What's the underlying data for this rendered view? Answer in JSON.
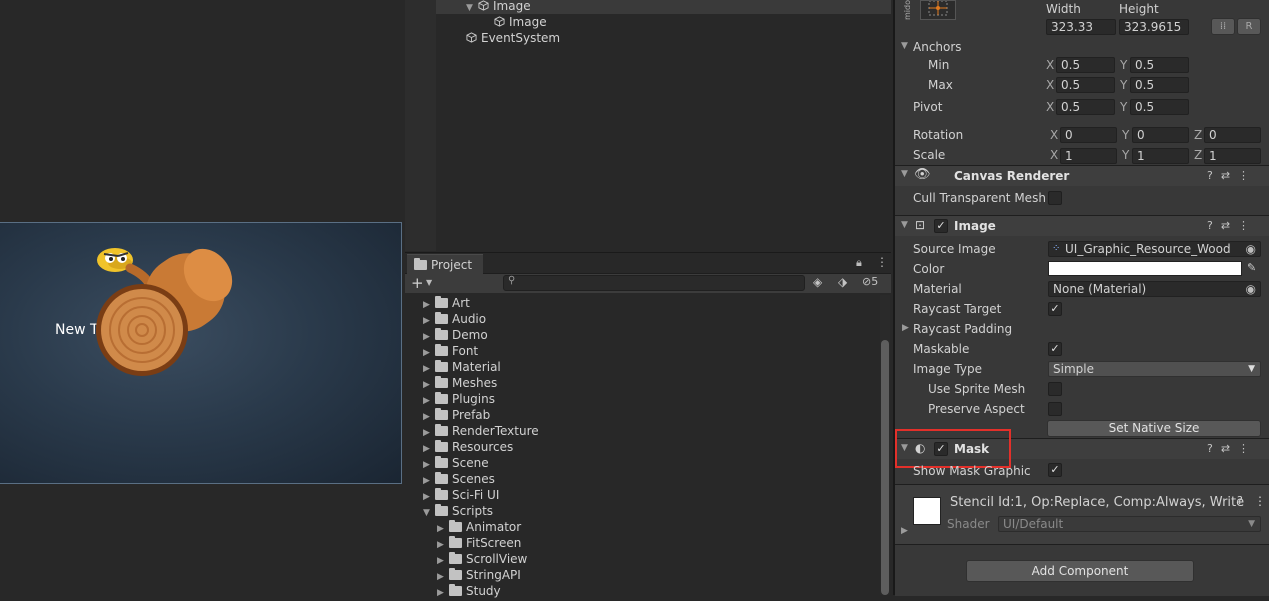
{
  "scene": {
    "text_label": "New T"
  },
  "hierarchy": {
    "items": [
      {
        "label": "Image",
        "depth": 1,
        "expanded": true
      },
      {
        "label": "Image",
        "depth": 2
      },
      {
        "label": "EventSystem",
        "depth": 0
      }
    ]
  },
  "project": {
    "tab_label": "Project",
    "hidden_count": "5",
    "folders": [
      "Art",
      "Audio",
      "Demo",
      "Font",
      "Material",
      "Meshes",
      "Plugins",
      "Prefab",
      "RenderTexture",
      "Resources",
      "Scene",
      "Scenes",
      "Sci-Fi UI",
      "Scripts"
    ],
    "script_children": [
      "Animator",
      "FitScreen",
      "ScrollView",
      "StringAPI",
      "Study"
    ]
  },
  "inspector": {
    "rect": {
      "preset_label": "mido",
      "width_label": "Width",
      "height_label": "Height",
      "width": "323.33",
      "height": "323.9615",
      "r_button": "R",
      "anchors_label": "Anchors",
      "min_label": "Min",
      "max_label": "Max",
      "min_x": "0.5",
      "min_y": "0.5",
      "max_x": "0.5",
      "max_y": "0.5",
      "pivot_label": "Pivot",
      "pivot_x": "0.5",
      "pivot_y": "0.5",
      "rotation_label": "Rotation",
      "rot_x": "0",
      "rot_y": "0",
      "rot_z": "0",
      "scale_label": "Scale",
      "scale_x": "1",
      "scale_y": "1",
      "scale_z": "1",
      "axis_x": "X",
      "axis_y": "Y",
      "axis_z": "Z"
    },
    "canvas_renderer": {
      "title": "Canvas Renderer",
      "cull_label": "Cull Transparent Mesh"
    },
    "image": {
      "title": "Image",
      "source_image_label": "Source Image",
      "source_image": "UI_Graphic_Resource_Wood",
      "color_label": "Color",
      "color_value": "#ffffff",
      "material_label": "Material",
      "material": "None (Material)",
      "raycast_target_label": "Raycast Target",
      "raycast_padding_label": "Raycast Padding",
      "maskable_label": "Maskable",
      "image_type_label": "Image Type",
      "image_type": "Simple",
      "use_sprite_mesh_label": "Use Sprite Mesh",
      "preserve_aspect_label": "Preserve Aspect",
      "set_native_size": "Set Native Size"
    },
    "mask": {
      "title": "Mask",
      "show_mask_graphic_label": "Show Mask Graphic"
    },
    "material_preview": {
      "stencil_info": "Stencil Id:1, Op:Replace, Comp:Always, Write",
      "shader_label": "Shader",
      "shader_value": "UI/Default"
    },
    "add_component": "Add Component"
  },
  "colors": {
    "highlight_box": "#e3302a",
    "panel_bg": "#383838"
  }
}
